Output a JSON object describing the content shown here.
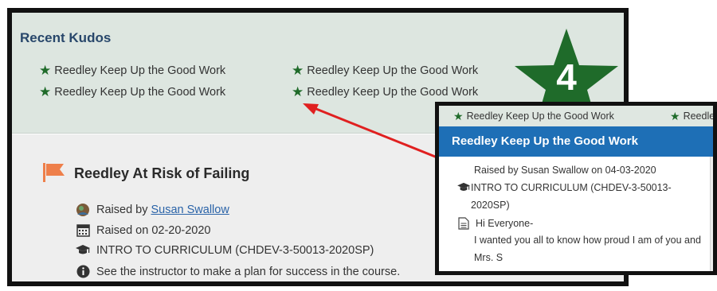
{
  "kudos": {
    "title": "Recent Kudos",
    "items": [
      "Reedley Keep Up the Good Work",
      "Reedley Keep Up the Good Work",
      "Reedley Keep Up the Good Work",
      "Reedley Keep Up the Good Work"
    ],
    "count": "4",
    "colors": {
      "star": "#1f6b2a",
      "panel_bg": "#dde6e0"
    }
  },
  "alert": {
    "title": "Reedley At Risk of Failing",
    "raised_by_label": "Raised by",
    "raised_by_name": "Susan Swallow",
    "raised_on": "Raised on 02-20-2020",
    "course": "INTRO TO CURRICULUM (CHDEV-3-50013-2020SP)",
    "advice": "See the instructor to make a plan for success in the course.",
    "colors": {
      "flag": "#ee7f4a"
    }
  },
  "popup": {
    "strip_items": [
      "Reedley Keep Up the Good Work",
      "Reedley"
    ],
    "header": "Reedley Keep Up the Good Work",
    "raised": "Raised by Susan Swallow on 04-03-2020",
    "course_line1": "INTRO TO CURRICULUM (CHDEV-3-50013-",
    "course_line2": "2020SP)",
    "greeting": "Hi Everyone-",
    "message": "I wanted you all to know how proud I am of you and",
    "signature": "Mrs. S",
    "colors": {
      "header_bg": "#1e6fb6"
    }
  },
  "annotation": {
    "arrow_color": "#e02020"
  }
}
